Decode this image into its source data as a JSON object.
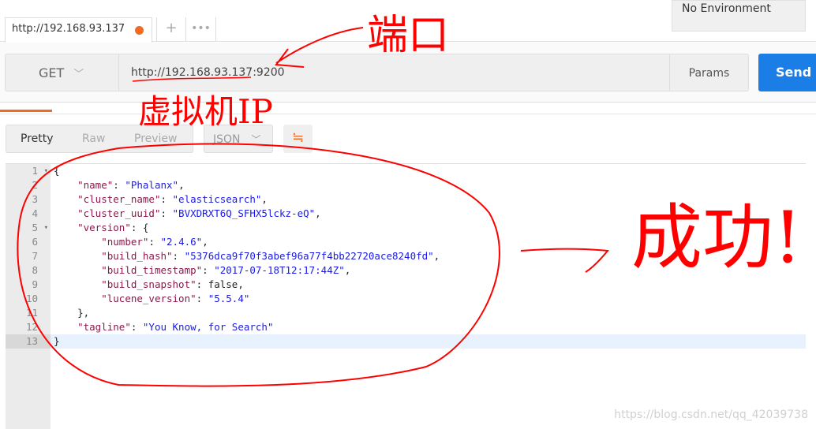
{
  "tab": {
    "title": "http://192.168.93.137",
    "unsaved_color": "#f26b21",
    "add_label": "+",
    "more_label": "•••"
  },
  "environment": {
    "selected": "No Environment"
  },
  "request": {
    "method": "GET",
    "url": "http://192.168.93.137:9200",
    "params_label": "Params",
    "send_label": "Send",
    "send_color": "#1a7ee6"
  },
  "response": {
    "view_modes": [
      "Pretty",
      "Raw",
      "Preview"
    ],
    "active_view": "Pretty",
    "format": "JSON",
    "wrap_icon": "wrap-lines-icon",
    "lines": [
      {
        "n": "1",
        "text": "{"
      },
      {
        "n": "2",
        "key": "\"name\"",
        "value": "\"Phalanx\"",
        "tail": ","
      },
      {
        "n": "3",
        "key": "\"cluster_name\"",
        "value": "\"elasticsearch\"",
        "tail": ","
      },
      {
        "n": "4",
        "key": "\"cluster_uuid\"",
        "value": "\"BVXDRXT6Q_SFHX5lckz-eQ\"",
        "tail": ","
      },
      {
        "n": "5",
        "key": "\"version\"",
        "tail": "{"
      },
      {
        "n": "6",
        "key": "\"number\"",
        "value": "\"2.4.6\"",
        "tail": ","
      },
      {
        "n": "7",
        "key": "\"build_hash\"",
        "value": "\"5376dca9f70f3abef96a77f4bb22720ace8240fd\"",
        "tail": ","
      },
      {
        "n": "8",
        "key": "\"build_timestamp\"",
        "value": "\"2017-07-18T12:17:44Z\"",
        "tail": ","
      },
      {
        "n": "9",
        "key": "\"build_snapshot\"",
        "tail": "false,"
      },
      {
        "n": "10",
        "key": "\"lucene_version\"",
        "value": "\"5.5.4\"",
        "tail": ""
      },
      {
        "n": "11",
        "text": "},"
      },
      {
        "n": "12",
        "key": "\"tagline\"",
        "value": "\"You Know, for Search\"",
        "tail": ""
      },
      {
        "n": "13",
        "text": "}"
      }
    ]
  },
  "annotations": {
    "port": "端口",
    "vm_ip": "虚拟机IP",
    "success": "成功!",
    "color": "#ff0000"
  },
  "watermark": "https://blog.csdn.net/qq_42039738"
}
